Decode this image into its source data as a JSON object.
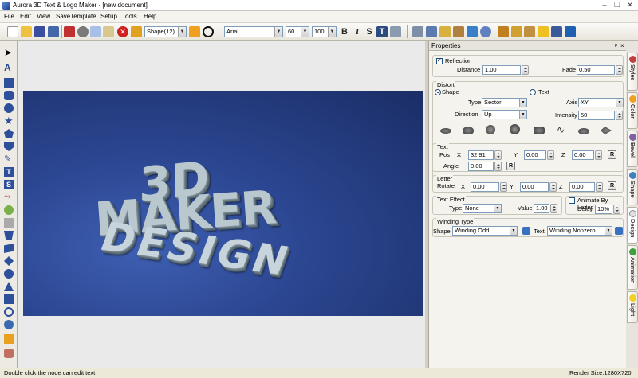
{
  "window": {
    "title": "Aurora 3D Text & Logo Maker - [new document]",
    "minimize": "–",
    "restore": "❐",
    "close": "✕"
  },
  "menu": [
    "File",
    "Edit",
    "View",
    "SaveTemplate",
    "Setup",
    "Tools",
    "Help"
  ],
  "toolbar": {
    "shape_combo": "Shape(12)",
    "font_combo": "Arial",
    "font_size": "60",
    "zoom": "100",
    "bold": "B",
    "italic": "I",
    "strike": "S",
    "text_T": "T"
  },
  "canvas": {
    "line1": "3D",
    "line2": "MAKER",
    "line3": "DESIGN"
  },
  "properties": {
    "title": "Properties",
    "pin": "ᵖ",
    "close": "×",
    "reflection": {
      "label": "Reflection",
      "distance_label": "Distance",
      "distance": "1.00",
      "fade_label": "Fade",
      "fade": "0.50"
    },
    "distort": {
      "label": "Distort",
      "shape_radio": "Shape",
      "text_radio": "Text",
      "type_label": "Type",
      "type": "Sector",
      "axis_label": "Axis",
      "axis": "XY",
      "direction_label": "Direction",
      "direction": "Up",
      "intensity_label": "Intensity",
      "intensity": "50"
    },
    "text": {
      "label": "Text",
      "pos_label": "Pos",
      "x_label": "X",
      "x": "32.91",
      "y_label": "Y",
      "y": "0.00",
      "z_label": "Z",
      "z": "0.00",
      "reset": "R",
      "angle_label": "Angle",
      "angle": "0.00"
    },
    "letter": {
      "label": "Letter",
      "rotate_label": "Rotate",
      "x_label": "X",
      "x": "0.00",
      "y_label": "Y",
      "y": "0.00",
      "z_label": "Z",
      "z": "0.00",
      "reset": "R"
    },
    "text_effect": {
      "label": "Text Effect",
      "type_label": "Type",
      "type": "None",
      "value_label": "Value",
      "value": "1.00"
    },
    "animate": {
      "label": "Animate By Letter",
      "delay_label": "Delay",
      "delay": "10%"
    },
    "winding": {
      "label": "Winding Type",
      "shape_label": "Shape",
      "shape": "Winding Odd",
      "text_label": "Text",
      "text": "Winding Nonzero"
    }
  },
  "side_tabs": [
    "Styles",
    "Color",
    "Bevel",
    "Shape",
    "Design",
    "Animation",
    "Light"
  ],
  "status": {
    "left": "Double click the node can edit text",
    "right": "Render Size:1280X720"
  }
}
